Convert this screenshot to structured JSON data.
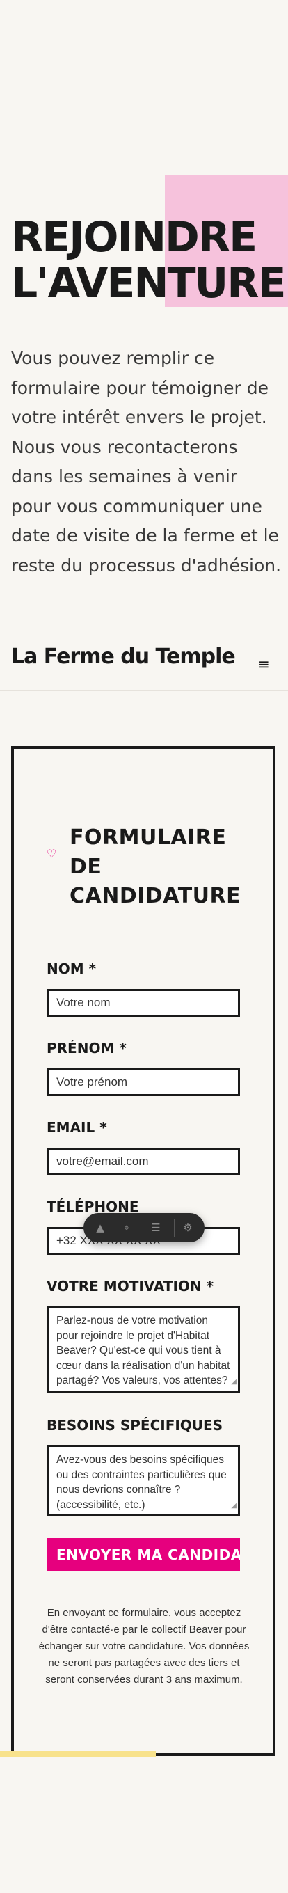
{
  "hero": {
    "title_line1": "REJOINDRE",
    "title_line2": "L'AVENTURE",
    "intro": "Vous pouvez remplir ce formulaire pour témoigner de votre intérêt envers le projet. Nous vous recontacterons dans les semaines à venir pour vous communiquer une date de visite de la ferme et le reste du processus d'adhésion."
  },
  "header": {
    "brand": "La Ferme du Temple",
    "menu_icon": "≡"
  },
  "form": {
    "heart_icon": "♡",
    "title_line1": "FORMULAIRE",
    "title_line2": "DE",
    "title_line3": "CANDIDATURE",
    "nom_label": "NOM *",
    "nom_placeholder": "Votre nom",
    "prenom_label": "PRÉNOM *",
    "prenom_placeholder": "Votre prénom",
    "email_label": "EMAIL *",
    "email_placeholder": "votre@email.com",
    "telephone_label": "TÉLÉPHONE",
    "telephone_placeholder": "+32 XXX XX XX XX",
    "motivation_label": "VOTRE MOTIVATION *",
    "motivation_placeholder": "Parlez-nous de votre motivation pour rejoindre le projet d'Habitat Beaver? Qu'est-ce qui vous tient à cœur dans la réalisation d'un habitat partagé? Vos valeurs, vos attentes?",
    "besoins_label": "BESOINS SPÉCIFIQUES",
    "besoins_placeholder": "Avez-vous des besoins spécifiques ou des contraintes particulières que nous devrions connaître ? (accessibilité, etc.)",
    "submit_label": "ENVOYER MA CANDIDATURE",
    "disclaimer": "En envoyant ce formulaire, vous acceptez d'être contacté·e par le collectif Beaver pour échanger sur votre candidature. Vos données ne seront pas partagées avec des tiers et seront conservées durant 3 ans maximum."
  },
  "toolbar": {
    "icons": [
      "logo-icon",
      "cursor-icon",
      "inspect-list-icon",
      "settings-icon"
    ],
    "glyph_logo": "▲",
    "glyph_cursor": "⌖",
    "glyph_inspect": "☰",
    "glyph_settings": "⚙"
  },
  "colors": {
    "accent_pink": "#e6007e",
    "block_pink": "#f6c2dc",
    "yellow": "#f8e28c",
    "background": "#f8f6f2",
    "ink": "#1a1a1a"
  }
}
